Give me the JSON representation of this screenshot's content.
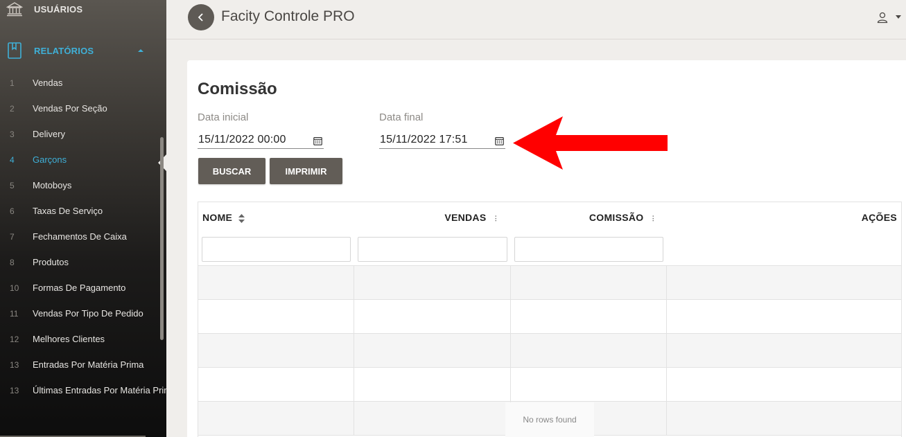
{
  "app": {
    "title": "Facity Controle PRO"
  },
  "sidebar": {
    "usuarios_label": "USUÁRIOS",
    "relatorios_label": "RELATÓRIOS",
    "items": [
      {
        "num": "1",
        "label": "Vendas"
      },
      {
        "num": "2",
        "label": "Vendas Por Seção"
      },
      {
        "num": "3",
        "label": "Delivery"
      },
      {
        "num": "4",
        "label": "Garçons"
      },
      {
        "num": "5",
        "label": "Motoboys"
      },
      {
        "num": "6",
        "label": "Taxas De Serviço"
      },
      {
        "num": "7",
        "label": "Fechamentos De Caixa"
      },
      {
        "num": "8",
        "label": "Produtos"
      },
      {
        "num": "10",
        "label": "Formas De Pagamento"
      },
      {
        "num": "11",
        "label": "Vendas Por Tipo De Pedido"
      },
      {
        "num": "12",
        "label": "Melhores Clientes"
      },
      {
        "num": "13",
        "label": "Entradas Por Matéria Prima"
      },
      {
        "num": "13",
        "label": "Últimas Entradas Por Matéria Prima"
      }
    ],
    "active_index": 3,
    "accent_color": "#3fb0d8"
  },
  "page": {
    "title": "Comissão",
    "start_date": {
      "label": "Data inicial",
      "value": "15/11/2022 00:00"
    },
    "end_date": {
      "label": "Data final",
      "value": "15/11/2022 17:51"
    },
    "buttons": {
      "search": "BUSCAR",
      "print": "IMPRIMIR"
    }
  },
  "table": {
    "columns": [
      "NOME",
      "VENDAS",
      "COMISSÃO",
      "AÇÕES"
    ],
    "empty_message": "No rows found"
  },
  "icons": {
    "back": "chevron-left-icon",
    "user": "user-icon",
    "calendar": "calendar-icon",
    "sort": "sort-icon",
    "annotation": "red-arrow-icon"
  }
}
